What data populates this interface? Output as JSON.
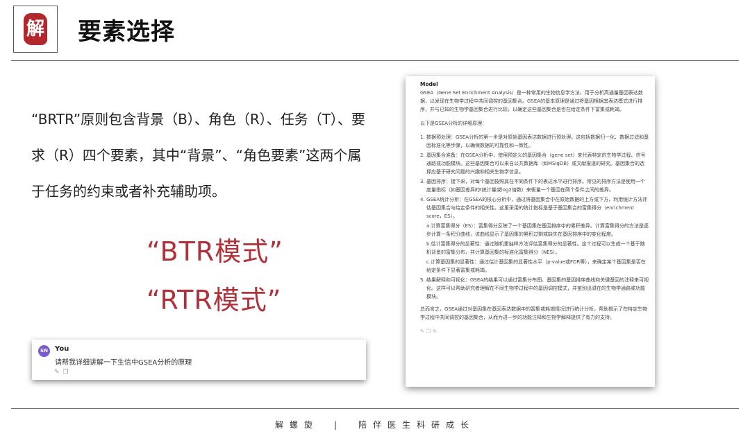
{
  "header": {
    "logo_char": "解",
    "title": "要素选择"
  },
  "intro_text": "“BRTR”原则包含背景（B）、角色（R）、任务（T）、要求（R）四个要素，其中“背景”、“角色要素”这两个属于任务的约束或者补充辅助项。",
  "modes": [
    "“BTR模式”",
    "“RTR模式”"
  ],
  "chat": {
    "avatar": "SN",
    "speaker": "You",
    "question": "请帮我详细讲解一下生信中GSEA分析的原理",
    "icons": [
      "edit-icon",
      "copy-icon"
    ]
  },
  "model": {
    "label": "Model",
    "intro": "GSEA（Gene Set Enrichment Analysis）是一种常用的生物信息学方法，用于分析高通量基因表达数据，以发现在生物学过程中共同调控的基因集合。GSEA的基本原理是通过将基因根据其表达模式进行排序，并与已知的生物学基因集合进行比较，以确定这些基因集合是否在给定条件下富集或耗竭。",
    "lead": "以下是GSEA分析的详细原理：",
    "steps": [
      {
        "num": "1.",
        "text": "数据预处理：GSEA分析的第一步是对原始基因表达数据进行预处理。这包括数据归一化、数据过滤和基因标准化等步骤，以确保数据的可靠性和一致性。"
      },
      {
        "num": "2.",
        "text": "基因集合准备：在GSEA分析中，使用预定义的基因集合（gene set）来代表特定的生物学过程、信号通路或功能模块。这些基因集合可以来自公共数据库（如MSigDB）或文献报道的研究。基因集合的选择应基于研究问题的兴趣和相关生物学信息。"
      },
      {
        "num": "3.",
        "text": "基因排序：接下来，对每个基因按照其在不同条件下的表达水平进行排序。常见的排序方法是使用一个度量指标（如基因差异的t统计量或log2倍数）来衡量一个基因在两个条件之间的差异。"
      },
      {
        "num": "4.",
        "text": "GSEA统计分析：在GSEA的核心分析中，通过将基因集合中在原始数据的上方或下方，利用统计方法评估基因集合与给定条件的相关性。这里采用的统计指标是基于基因集合的富集得分（enrichment score，ES）。"
      }
    ],
    "sub_steps": [
      "a.计算富集得分（ES）：富集得分反映了一个基因集在基因排序中的累积差异。计算富集得分的方法是逐步计算一条积分曲线，该曲线显示了基因集的累积过剩或缺失在基因排序中的变化程度。",
      "b.估计富集得分的显著性：通过随机重抽样方法评估富集得分的显著性。这个过程可以生成一个基于随机背景的富集分布，并计算基因集的标准化富集得分（NES）。",
      "c.计算基因集的显著性：通过估计基因集的显著性水平（p-value或FDR等），来确定某个基因集是否在给定条件下显著富集或耗竭。"
    ],
    "step5": {
      "num": "5.",
      "text": "结果解释和可视化：GSEA的结果可以通过富集分布图、基因集的基因排序曲线和关键基因的注释来可视化。这样可以帮助研究者理解在不同生物学过程中的基因调控模式，并鉴别出潜在的生物学通路或功能模块。"
    },
    "conclusion": "总而言之，GSEA通过对基因集在基因表达数据中的富集或耗竭情况进行统计分析，帮助揭示了在特定生物学过程中共同调控的基因集合，从而为进一步的功能注释和生物学解释提供了有力的支持。",
    "icons": [
      "edit-icon",
      "copy-icon",
      "refresh-icon"
    ]
  },
  "footer": {
    "left": "解螺旋",
    "separator": "|",
    "right": "陪伴医生科研成长"
  }
}
